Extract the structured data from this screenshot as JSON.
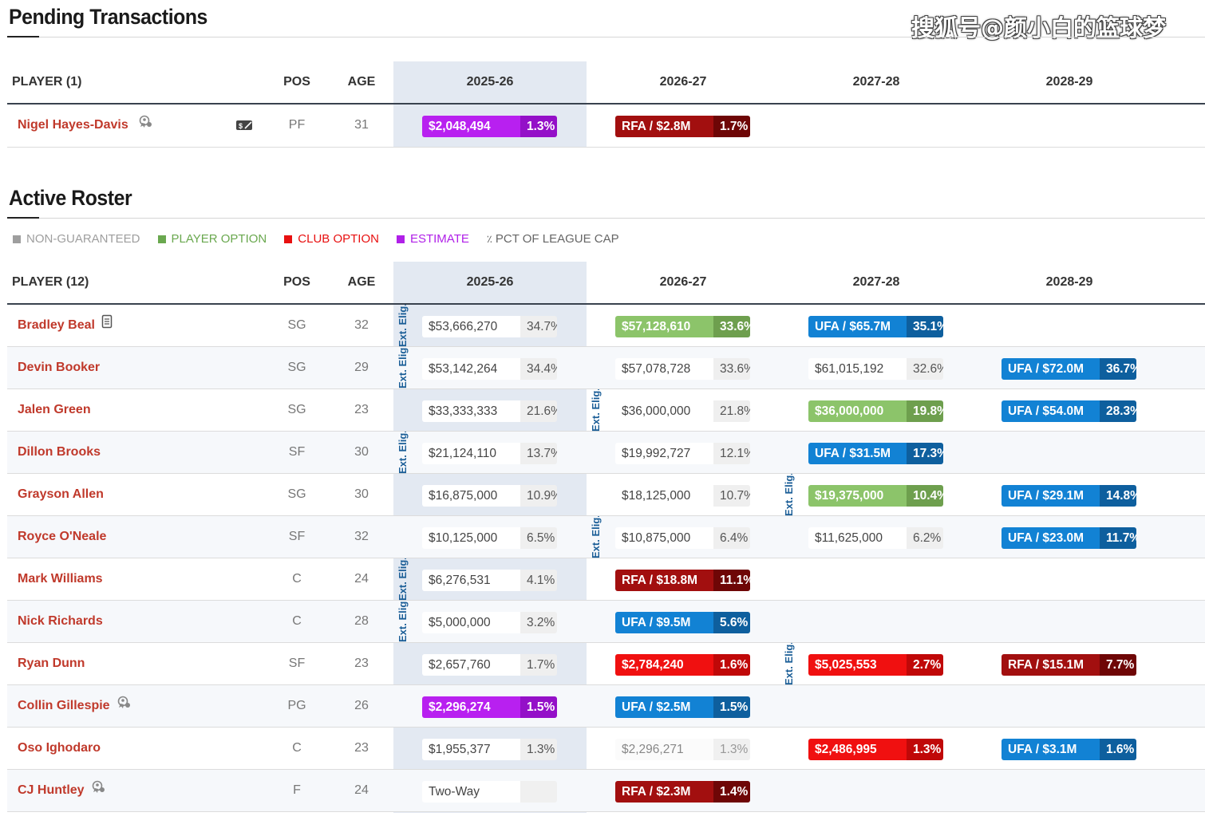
{
  "watermark": "搜狐号@颜小白的篮球梦",
  "pending": {
    "title": "Pending Transactions",
    "headers": {
      "player": "PLAYER (1)",
      "pos": "POS",
      "age": "AGE",
      "y1": "2025-26",
      "y2": "2026-27",
      "y3": "2027-28",
      "y4": "2028-29"
    },
    "rows": [
      {
        "name": "Nigel Hayes-Davis",
        "pos": "PF",
        "age": "31",
        "c1": {
          "amt": "$2,048,494",
          "pct": "1.3%"
        },
        "c2": {
          "amt": "RFA / $2.8M",
          "pct": "1.7%"
        }
      }
    ]
  },
  "roster": {
    "title": "Active Roster",
    "legend": [
      {
        "label": "NON-GUARANTEED",
        "color": "#9e9e9e"
      },
      {
        "label": "PLAYER OPTION",
        "color": "#6aa84f"
      },
      {
        "label": "CLUB OPTION",
        "color": "#e81010"
      },
      {
        "label": "ESTIMATE",
        "color": "#b020e8"
      },
      {
        "label": "PCT OF LEAGUE CAP",
        "color": "#666666",
        "icon": "percent-icon"
      }
    ],
    "headers": {
      "player": "PLAYER (12)",
      "pos": "POS",
      "age": "AGE",
      "y1": "2025-26",
      "y2": "2026-27",
      "y3": "2027-28",
      "y4": "2028-29"
    },
    "ext_label": "Ext. Elig.",
    "rows": [
      {
        "name": "Bradley Beal",
        "pos": "SG",
        "age": "32",
        "c1": {
          "amt": "$53,666,270",
          "pct": "34.7%"
        },
        "c2": {
          "amt": "$57,128,610",
          "pct": "33.6%"
        },
        "c3": {
          "amt": "UFA / $65.7M",
          "pct": "35.1%"
        }
      },
      {
        "name": "Devin Booker",
        "pos": "SG",
        "age": "29",
        "c1": {
          "amt": "$53,142,264",
          "pct": "34.4%"
        },
        "c2": {
          "amt": "$57,078,728",
          "pct": "33.6%"
        },
        "c3": {
          "amt": "$61,015,192",
          "pct": "32.6%"
        },
        "c4": {
          "amt": "UFA / $72.0M",
          "pct": "36.7%"
        }
      },
      {
        "name": "Jalen Green",
        "pos": "SG",
        "age": "23",
        "c1": {
          "amt": "$33,333,333",
          "pct": "21.6%"
        },
        "c2": {
          "amt": "$36,000,000",
          "pct": "21.8%"
        },
        "c3": {
          "amt": "$36,000,000",
          "pct": "19.8%"
        },
        "c4": {
          "amt": "UFA / $54.0M",
          "pct": "28.3%"
        }
      },
      {
        "name": "Dillon Brooks",
        "pos": "SF",
        "age": "30",
        "c1": {
          "amt": "$21,124,110",
          "pct": "13.7%"
        },
        "c2": {
          "amt": "$19,992,727",
          "pct": "12.1%"
        },
        "c3": {
          "amt": "UFA / $31.5M",
          "pct": "17.3%"
        }
      },
      {
        "name": "Grayson Allen",
        "pos": "SG",
        "age": "30",
        "c1": {
          "amt": "$16,875,000",
          "pct": "10.9%"
        },
        "c2": {
          "amt": "$18,125,000",
          "pct": "10.7%"
        },
        "c3": {
          "amt": "$19,375,000",
          "pct": "10.4%"
        },
        "c4": {
          "amt": "UFA / $29.1M",
          "pct": "14.8%"
        }
      },
      {
        "name": "Royce O'Neale",
        "pos": "SF",
        "age": "32",
        "c1": {
          "amt": "$10,125,000",
          "pct": "6.5%"
        },
        "c2": {
          "amt": "$10,875,000",
          "pct": "6.4%"
        },
        "c3": {
          "amt": "$11,625,000",
          "pct": "6.2%"
        },
        "c4": {
          "amt": "UFA / $23.0M",
          "pct": "11.7%"
        }
      },
      {
        "name": "Mark Williams",
        "pos": "C",
        "age": "24",
        "c1": {
          "amt": "$6,276,531",
          "pct": "4.1%"
        },
        "c2": {
          "amt": "RFA / $18.8M",
          "pct": "11.1%"
        }
      },
      {
        "name": "Nick Richards",
        "pos": "C",
        "age": "28",
        "c1": {
          "amt": "$5,000,000",
          "pct": "3.2%"
        },
        "c2": {
          "amt": "UFA / $9.5M",
          "pct": "5.6%"
        }
      },
      {
        "name": "Ryan Dunn",
        "pos": "SF",
        "age": "23",
        "c1": {
          "amt": "$2,657,760",
          "pct": "1.7%"
        },
        "c2": {
          "amt": "$2,784,240",
          "pct": "1.6%"
        },
        "c3": {
          "amt": "$5,025,553",
          "pct": "2.7%"
        },
        "c4": {
          "amt": "RFA / $15.1M",
          "pct": "7.7%"
        }
      },
      {
        "name": "Collin Gillespie",
        "pos": "PG",
        "age": "26",
        "c1": {
          "amt": "$2,296,274",
          "pct": "1.5%"
        },
        "c2": {
          "amt": "UFA / $2.5M",
          "pct": "1.5%"
        }
      },
      {
        "name": "Oso Ighodaro",
        "pos": "C",
        "age": "23",
        "c1": {
          "amt": "$1,955,377",
          "pct": "1.3%"
        },
        "c2": {
          "amt": "$2,296,271",
          "pct": "1.3%"
        },
        "c3": {
          "amt": "$2,486,995",
          "pct": "1.3%"
        },
        "c4": {
          "amt": "UFA / $3.1M",
          "pct": "1.6%"
        }
      },
      {
        "name": "CJ Huntley",
        "pos": "F",
        "age": "24",
        "c1": {
          "amt": "Two-Way",
          "pct": ""
        },
        "c2": {
          "amt": "RFA / $2.3M",
          "pct": "1.4%"
        }
      }
    ]
  }
}
